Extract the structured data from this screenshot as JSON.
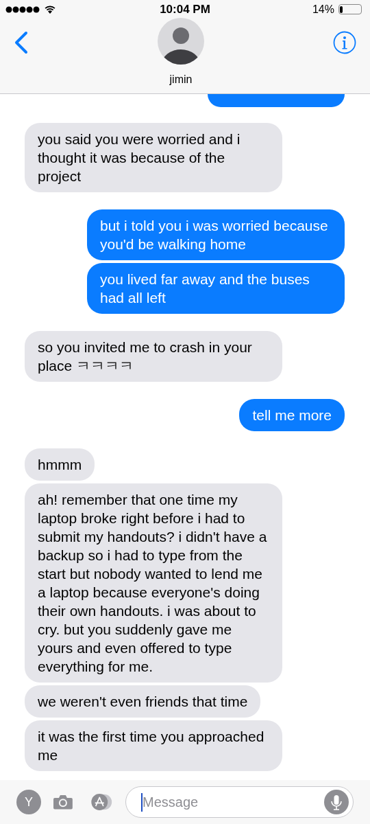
{
  "status_bar": {
    "time": "10:04 PM",
    "battery_percent": "14%"
  },
  "header": {
    "contact_name": "jimin"
  },
  "groups": [
    {
      "kind": "received",
      "messages": [
        "you said you were worried and i thought it was because of the project"
      ]
    },
    {
      "kind": "sent",
      "messages": [
        "but i told you i was worried because you'd be walking home",
        "you lived far away and the buses had all left"
      ]
    },
    {
      "kind": "received",
      "messages": [
        "so you invited me to crash in your place ㅋㅋㅋㅋ"
      ]
    },
    {
      "kind": "sent",
      "messages": [
        "tell me more"
      ]
    },
    {
      "kind": "received",
      "messages": [
        "hmmm",
        "ah! remember that one time my laptop broke right before i had to submit my handouts? i didn't have a backup so i had to type from the start but nobody wanted to lend me a laptop because everyone's doing their own handouts. i was about to cry. but you suddenly gave me yours and even offered to type everything for me.",
        "we weren't even friends that time",
        "it was the first time you approached me"
      ]
    }
  ],
  "compose": {
    "avatar_letter": "Y",
    "placeholder": "Message"
  }
}
